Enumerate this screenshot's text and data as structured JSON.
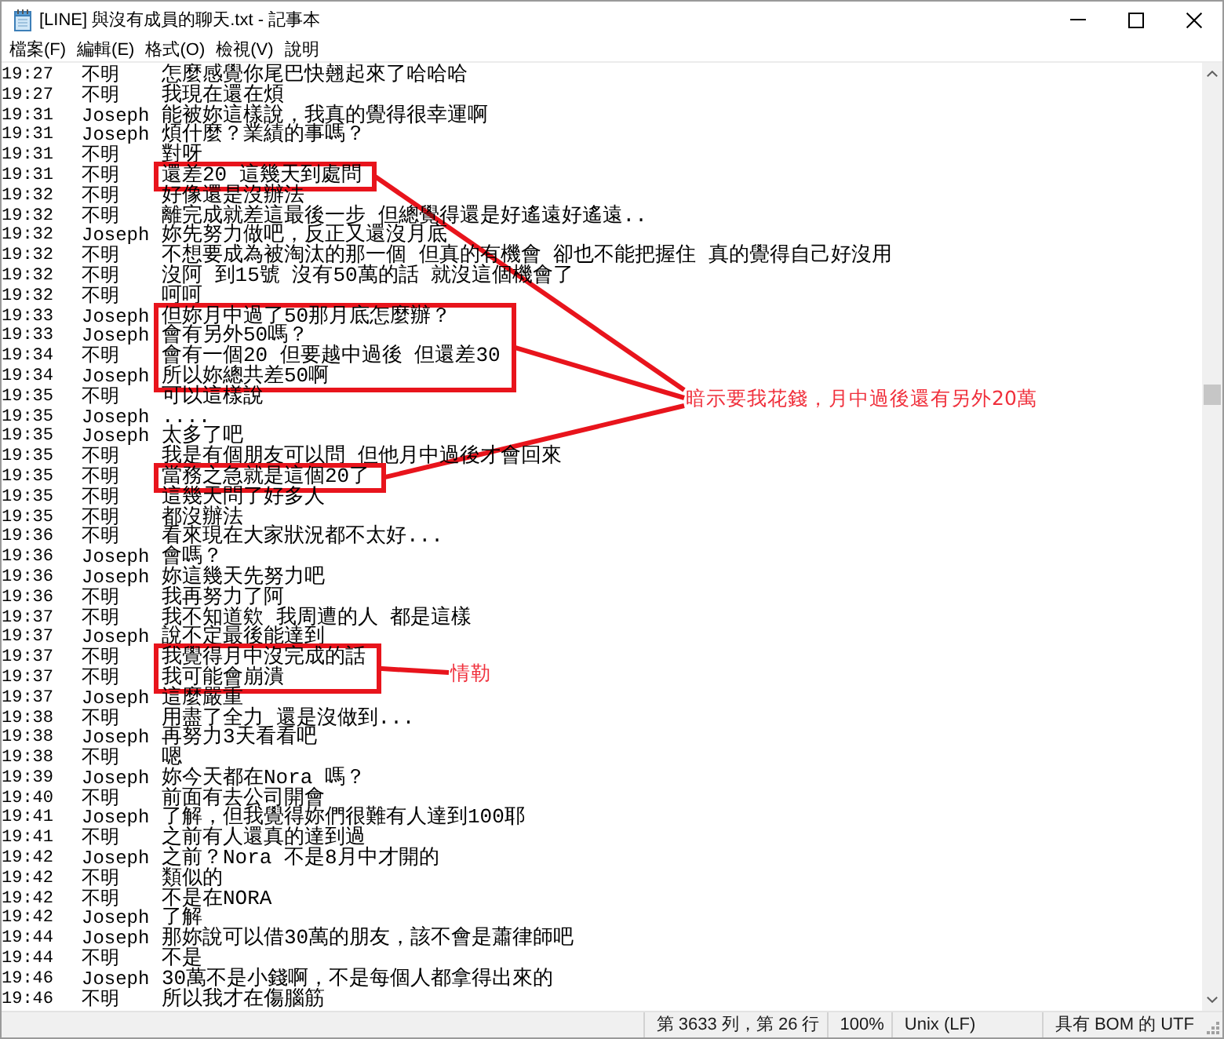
{
  "window": {
    "title": "[LINE] 與沒有成員的聊天.txt - 記事本"
  },
  "menu": [
    "檔案(F)",
    "編輯(E)",
    "格式(O)",
    "檢視(V)",
    "說明"
  ],
  "lines": [
    {
      "time": "19:27",
      "sender": "不明",
      "text": "怎麼感覺你尾巴快翹起來了哈哈哈",
      "highlighted": false
    },
    {
      "time": "19:27",
      "sender": "不明",
      "text": "我現在還在煩",
      "highlighted": false
    },
    {
      "time": "19:31",
      "sender": "Joseph",
      "text": "能被妳這樣說，我真的覺得很幸運啊",
      "highlighted": false
    },
    {
      "time": "19:31",
      "sender": "Joseph",
      "text": "煩什麼？業績的事嗎？",
      "highlighted": false
    },
    {
      "time": "19:31",
      "sender": "不明",
      "text": "對呀",
      "highlighted": false
    },
    {
      "time": "19:31",
      "sender": "不明",
      "text": "還差20 這幾天到處問",
      "highlighted": true
    },
    {
      "time": "19:32",
      "sender": "不明",
      "text": "好像還是沒辦法",
      "highlighted": false
    },
    {
      "time": "19:32",
      "sender": "不明",
      "text": "離完成就差這最後一步 但總覺得還是好遙遠好遙遠..",
      "highlighted": false
    },
    {
      "time": "19:32",
      "sender": "Joseph",
      "text": "妳先努力做吧，反正又還沒月底",
      "highlighted": false
    },
    {
      "time": "19:32",
      "sender": "不明",
      "text": "不想要成為被淘汰的那一個 但真的有機會 卻也不能把握住 真的覺得自己好沒用",
      "highlighted": false
    },
    {
      "time": "19:32",
      "sender": "不明",
      "text": "沒阿 到15號 沒有50萬的話 就沒這個機會了",
      "highlighted": false
    },
    {
      "time": "19:32",
      "sender": "不明",
      "text": "呵呵",
      "highlighted": false
    },
    {
      "time": "19:33",
      "sender": "Joseph",
      "text": "但妳月中過了50那月底怎麼辦？",
      "highlighted": true
    },
    {
      "time": "19:33",
      "sender": "Joseph",
      "text": "會有另外50嗎？",
      "highlighted": true
    },
    {
      "time": "19:34",
      "sender": "不明",
      "text": "會有一個20 但要越中過後 但還差30",
      "highlighted": true
    },
    {
      "time": "19:34",
      "sender": "Joseph",
      "text": "所以妳總共差50啊",
      "highlighted": true
    },
    {
      "time": "19:35",
      "sender": "不明",
      "text": "可以這樣說",
      "highlighted": false
    },
    {
      "time": "19:35",
      "sender": "Joseph",
      "text": "....",
      "highlighted": false
    },
    {
      "time": "19:35",
      "sender": "Joseph",
      "text": "太多了吧",
      "highlighted": false
    },
    {
      "time": "19:35",
      "sender": "不明",
      "text": "我是有個朋友可以問 但他月中過後才會回來",
      "highlighted": false
    },
    {
      "time": "19:35",
      "sender": "不明",
      "text": "當務之急就是這個20了",
      "highlighted": true
    },
    {
      "time": "19:35",
      "sender": "不明",
      "text": "這幾天問了好多人",
      "highlighted": false
    },
    {
      "time": "19:35",
      "sender": "不明",
      "text": "都沒辦法",
      "highlighted": false
    },
    {
      "time": "19:36",
      "sender": "不明",
      "text": "看來現在大家狀況都不太好...",
      "highlighted": false
    },
    {
      "time": "19:36",
      "sender": "Joseph",
      "text": "會嗎？",
      "highlighted": false
    },
    {
      "time": "19:36",
      "sender": "Joseph",
      "text": "妳這幾天先努力吧",
      "highlighted": false
    },
    {
      "time": "19:36",
      "sender": "不明",
      "text": "我再努力了阿",
      "highlighted": false
    },
    {
      "time": "19:37",
      "sender": "不明",
      "text": "我不知道欸 我周遭的人 都是這樣",
      "highlighted": false
    },
    {
      "time": "19:37",
      "sender": "Joseph",
      "text": "說不定最後能達到",
      "highlighted": false
    },
    {
      "time": "19:37",
      "sender": "不明",
      "text": "我覺得月中沒完成的話",
      "highlighted": true
    },
    {
      "time": "19:37",
      "sender": "不明",
      "text": "我可能會崩潰",
      "highlighted": true
    },
    {
      "time": "19:37",
      "sender": "Joseph",
      "text": "這麼嚴重",
      "highlighted": false
    },
    {
      "time": "19:38",
      "sender": "不明",
      "text": "用盡了全力 還是沒做到...",
      "highlighted": false
    },
    {
      "time": "19:38",
      "sender": "Joseph",
      "text": "再努力3天看看吧",
      "highlighted": false
    },
    {
      "time": "19:38",
      "sender": "不明",
      "text": "嗯",
      "highlighted": false
    },
    {
      "time": "19:39",
      "sender": "Joseph",
      "text": "妳今天都在Nora 嗎？",
      "highlighted": false
    },
    {
      "time": "19:40",
      "sender": "不明",
      "text": "前面有去公司開會",
      "highlighted": false
    },
    {
      "time": "19:41",
      "sender": "Joseph",
      "text": "了解，但我覺得妳們很難有人達到100耶",
      "highlighted": false
    },
    {
      "time": "19:41",
      "sender": "不明",
      "text": "之前有人還真的達到過",
      "highlighted": false
    },
    {
      "time": "19:42",
      "sender": "Joseph",
      "text": "之前？Nora 不是8月中才開的",
      "highlighted": false
    },
    {
      "time": "19:42",
      "sender": "不明",
      "text": "類似的",
      "highlighted": false
    },
    {
      "time": "19:42",
      "sender": "不明",
      "text": "不是在NORA",
      "highlighted": false
    },
    {
      "time": "19:42",
      "sender": "Joseph",
      "text": "了解",
      "highlighted": false
    },
    {
      "time": "19:44",
      "sender": "Joseph",
      "text": "那妳說可以借30萬的朋友，該不會是蕭律師吧",
      "highlighted": false
    },
    {
      "time": "19:44",
      "sender": "不明",
      "text": "不是",
      "highlighted": false
    },
    {
      "time": "19:46",
      "sender": "Joseph",
      "text": "30萬不是小錢啊，不是每個人都拿得出來的",
      "highlighted": false
    },
    {
      "time": "19:46",
      "sender": "不明",
      "text": "所以我才在傷腦筋",
      "highlighted": false
    }
  ],
  "callouts": [
    {
      "text": "暗示要我花錢，月中過後還有另外20萬"
    },
    {
      "text": "情勒"
    }
  ],
  "status_bar": {
    "position": "第 3633 列，第 26 行",
    "zoom": "100%",
    "line_ending": "Unix (LF)",
    "encoding": "具有 BOM 的 UTF"
  }
}
